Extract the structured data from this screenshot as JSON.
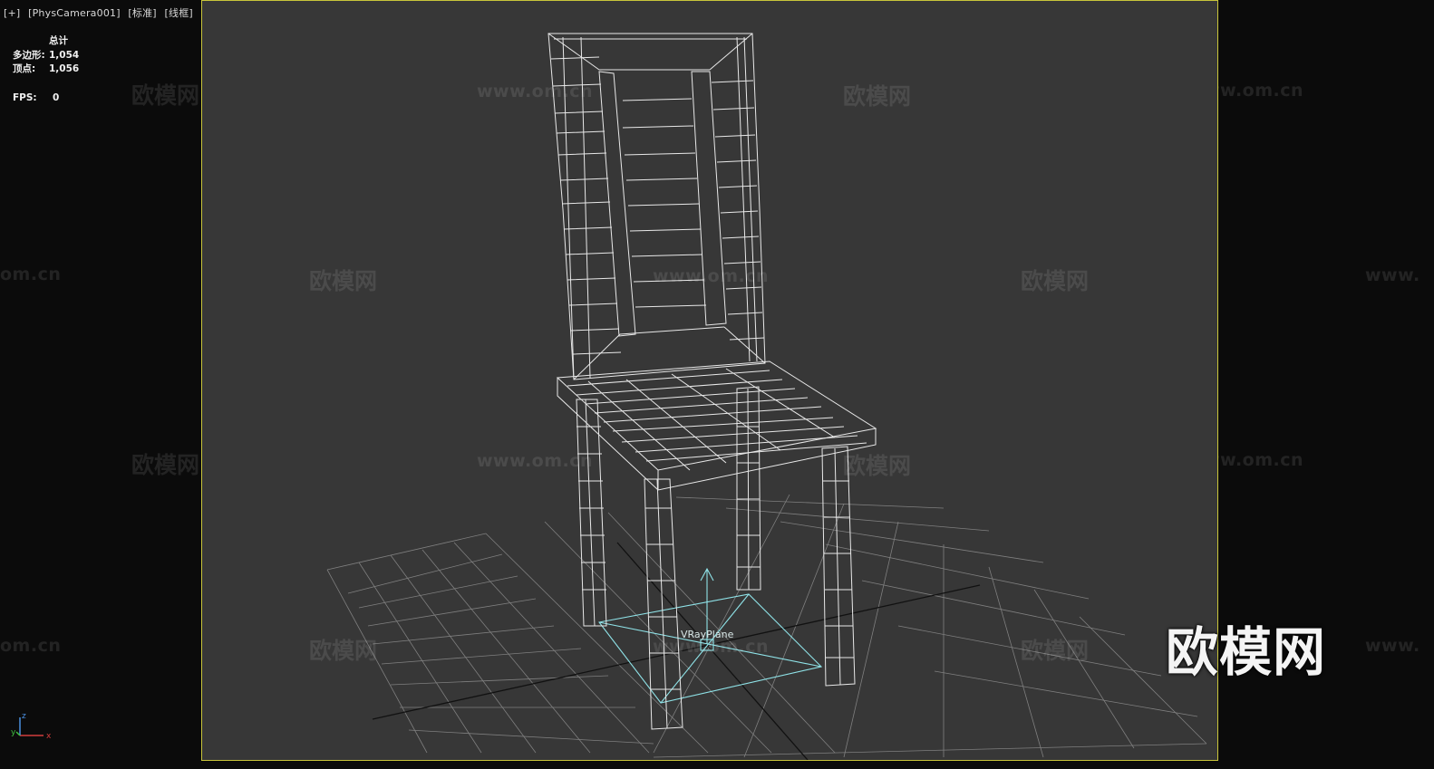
{
  "viewport": {
    "labels": [
      "[+]",
      "[PhysCamera001]",
      "[标准]",
      "[线框]"
    ]
  },
  "stats": {
    "header": "总计",
    "rows": [
      {
        "label": "多边形:",
        "value": "1,054"
      },
      {
        "label": "顶点:",
        "value": "1,056"
      }
    ],
    "fps_label": "FPS:",
    "fps_value": "0"
  },
  "scene": {
    "object_label": "VRayPlane"
  },
  "axis_gizmo": {
    "x": "x",
    "y": "y",
    "z": "z"
  },
  "watermarks": {
    "logo_text": "欧模网",
    "url_text": "www.om.cn",
    "url_fragment_left": "om.cn",
    "url_fragment_right": "www."
  },
  "colors": {
    "viewport_bg": "#373737",
    "viewport_border": "#c9c53a",
    "wireframe": "#e8e8e8",
    "grid": "#8a8a8a",
    "vray_plane": "#8fe3e8"
  }
}
